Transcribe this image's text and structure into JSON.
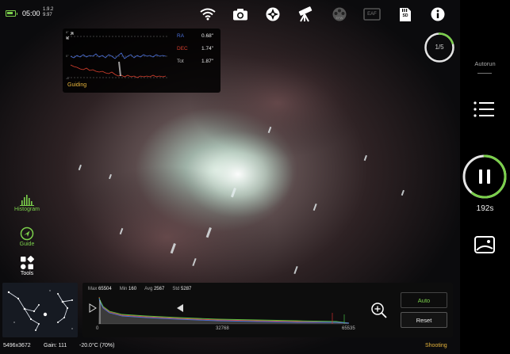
{
  "status_bar": {
    "clock": "05:00",
    "version_top": "1.9.2",
    "version_bottom": "9.97"
  },
  "top_icons": [
    "wifi-icon",
    "camera-icon",
    "mount-icon",
    "telescope-icon",
    "efw-icon",
    "eaf-icon",
    "sd-card-icon",
    "info-icon"
  ],
  "top_labels": {
    "efw": "EFW",
    "eaf": "EAF",
    "sd": "SD"
  },
  "guiding": {
    "title": "Guiding",
    "ra_label": "RA",
    "ra_value": "0.68\"",
    "dec_label": "DEC",
    "dec_value": "1.74\"",
    "tot_label": "Tot",
    "tot_value": "1.87\"",
    "tick_top": "8\"",
    "tick_mid": "0\"",
    "tick_bottom": "-8\"",
    "ra_color": "#4a6fd8",
    "dec_color": "#d8402e"
  },
  "sequence": {
    "progress": "1/5",
    "progress_fraction": 0.2,
    "autorun_label": "Autorun",
    "remaining": "192s",
    "remaining_fraction": 0.6
  },
  "left_tools": {
    "histogram": "Histogram",
    "guide": "Guide",
    "tools": "Tools"
  },
  "histogram": {
    "max_label": "Max",
    "max_value": "65504",
    "min_label": "Min",
    "min_value": "160",
    "avg_label": "Avg",
    "avg_value": "2567",
    "std_label": "Std",
    "std_value": "5287",
    "axis_left": "0",
    "axis_mid": "32768",
    "axis_right": "65535",
    "auto_label": "Auto",
    "reset_label": "Reset"
  },
  "image_info": {
    "resolution": "5496x3672",
    "gain": "Gain: 111",
    "temperature": "-20.0°C (70%)",
    "state": "Shooting"
  },
  "colors": {
    "accent_green": "#7bd04b",
    "accent_yellow": "#e7b53c"
  }
}
